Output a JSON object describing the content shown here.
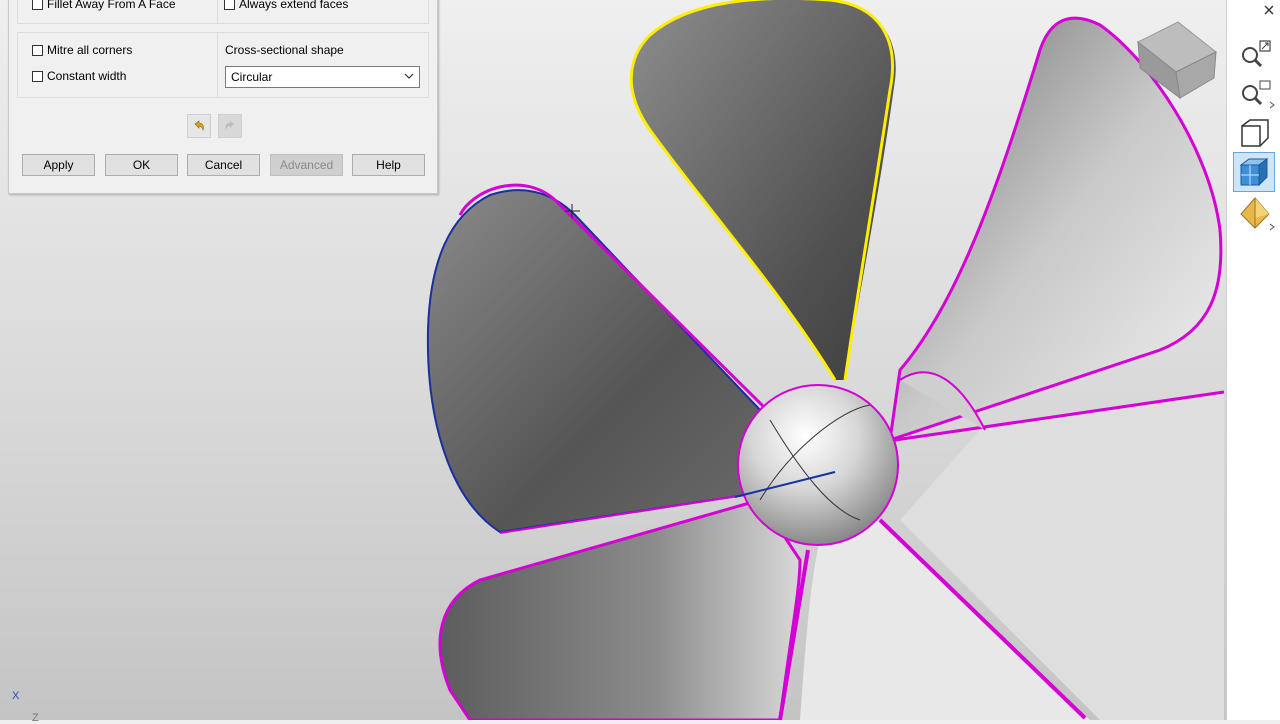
{
  "dialog": {
    "checkbox_fillet_away": "Fillet Away From A Face",
    "checkbox_always_extend": "Always extend faces",
    "checkbox_mitre": "Mitre all corners",
    "checkbox_constant_width": "Constant width",
    "cross_section_label": "Cross-sectional shape",
    "cross_section_value": "Circular",
    "buttons": {
      "apply": "Apply",
      "ok": "OK",
      "cancel": "Cancel",
      "advanced": "Advanced",
      "help": "Help"
    }
  },
  "toolbar": {
    "icons": [
      "close-icon",
      "zoom-fit-icon",
      "zoom-icon",
      "wireframe-view-icon",
      "shaded-view-icon",
      "view-orientation-icon"
    ]
  },
  "triad": {
    "x_label": "X",
    "z_label": "Z"
  },
  "colors": {
    "selected_edge": "#d400d4",
    "highlight_edge": "#ffee00",
    "preview_edge": "#1a2fa0",
    "accent": "#2a7fd4"
  }
}
